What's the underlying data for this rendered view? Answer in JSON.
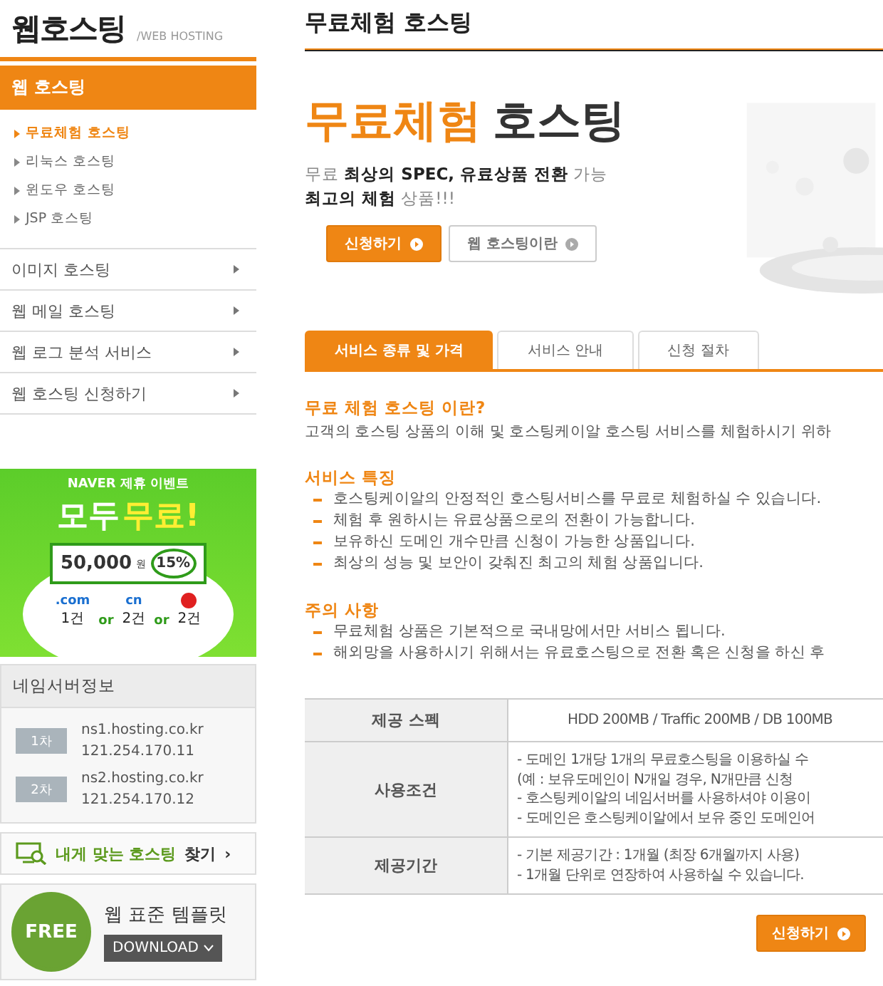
{
  "sidebar": {
    "logo": "웹호스팅",
    "logo_sub": "/WEB HOSTING",
    "section": "웹 호스팅",
    "sub_items": [
      {
        "label": "무료체험 호스팅",
        "selected": true
      },
      {
        "label": "리눅스 호스팅",
        "selected": false
      },
      {
        "label": "윈도우 호스팅",
        "selected": false
      },
      {
        "label": "JSP 호스팅",
        "selected": false
      }
    ],
    "menu": [
      "이미지 호스팅",
      "웹 메일 호스팅",
      "웹 로그 분석 서비스",
      "웹 호스팅 신청하기"
    ],
    "banner": {
      "top": "NAVER 제휴 이벤트",
      "headline": "모두",
      "highlight": "무료!",
      "amount": "50,000",
      "unit": "원",
      "percent": "15%",
      "domains": [
        {
          "kind": "text",
          "label": ".com",
          "count": "1건"
        },
        {
          "kind": "text",
          "joiner": "or",
          "label": "cn",
          "count": "2건"
        },
        {
          "kind": "icon",
          "joiner": "or",
          "count": "2건"
        }
      ]
    },
    "nameservers": {
      "title": "네임서버정보",
      "entries": [
        {
          "label": "1차",
          "host": "ns1.hosting.co.kr",
          "ip": "121.254.170.11"
        },
        {
          "label": "2차",
          "host": "ns2.hosting.co.kr",
          "ip": "121.254.170.12"
        }
      ]
    },
    "finder": {
      "highlight": "내게 맞는 호스팅",
      "rest": "찾기",
      "arrow": "›"
    },
    "template": {
      "badge": "FREE",
      "title": "웹 표준 템플릿",
      "button": "DOWNLOAD"
    }
  },
  "main": {
    "title": "무료체험 호스팅",
    "hero": {
      "headline_accent": "무료체험",
      "headline": "호스팅",
      "lines": [
        "무료 **최상의 SPEC, 유료상품 전환** 가능",
        "**최고의 체험** 상품!!!"
      ],
      "buttons": [
        {
          "label": "신청하기",
          "kind": "primary"
        },
        {
          "label": "웹 호스팅이란",
          "kind": "secondary"
        }
      ]
    },
    "tabs": [
      {
        "label": "서비스 종류 및 가격",
        "selected": true
      },
      {
        "label": "서비스 안내",
        "selected": false
      },
      {
        "label": "신청 절차",
        "selected": false
      }
    ],
    "sections": [
      {
        "heading": "무료 체험 호스팅 이란?",
        "kind": "paragraph",
        "lines": [
          "고객의 호스팅 상품의 이해 및 호스팅케이알 호스팅 서비스를 체험하시기 위하"
        ]
      },
      {
        "heading": "서비스 특징",
        "kind": "bullets",
        "lines": [
          "호스팅케이알의 안정적인 호스팅서비스를 무료로 체험하실 수 있습니다.",
          "체험 후 원하시는 유료상품으로의 전환이 가능합니다.",
          "보유하신 도메인 개수만큼 신청이 가능한 상품입니다.",
          "최상의 성능 및 보안이 갖춰진 최고의 체험 상품입니다."
        ]
      },
      {
        "heading": "주의 사항",
        "kind": "bullets",
        "lines": [
          "무료체험 상품은 기본적으로 국내망에서만 서비스 됩니다.",
          "해외망을 사용하시기 위해서는 유료호스팅으로 전환 혹은 신청을 하신 후"
        ]
      }
    ],
    "table": [
      {
        "head": "제공 스펙",
        "lines": [
          "HDD 200MB / Traffic 200MB / DB 100MB"
        ],
        "kind": "single"
      },
      {
        "head": "사용조건",
        "lines": [
          "- 도메인 1개당 1개의 무료호스팅을 이용하실 수",
          "(예 : 보유도메인이 N개일 경우, N개만큼 신청",
          "- 호스팅케이알의 네임서버를 사용하셔야 이용이",
          "- 도메인은 호스팅케이알에서 보유 중인 도메인어"
        ],
        "kind": "list"
      },
      {
        "head": "제공기간",
        "lines": [
          "- 기본 제공기간 : 1개월 (최장 6개월까지 사용)",
          "- 1개월 단위로 연장하여 사용하실 수 있습니다."
        ],
        "kind": "list"
      }
    ],
    "apply": "신청하기"
  }
}
